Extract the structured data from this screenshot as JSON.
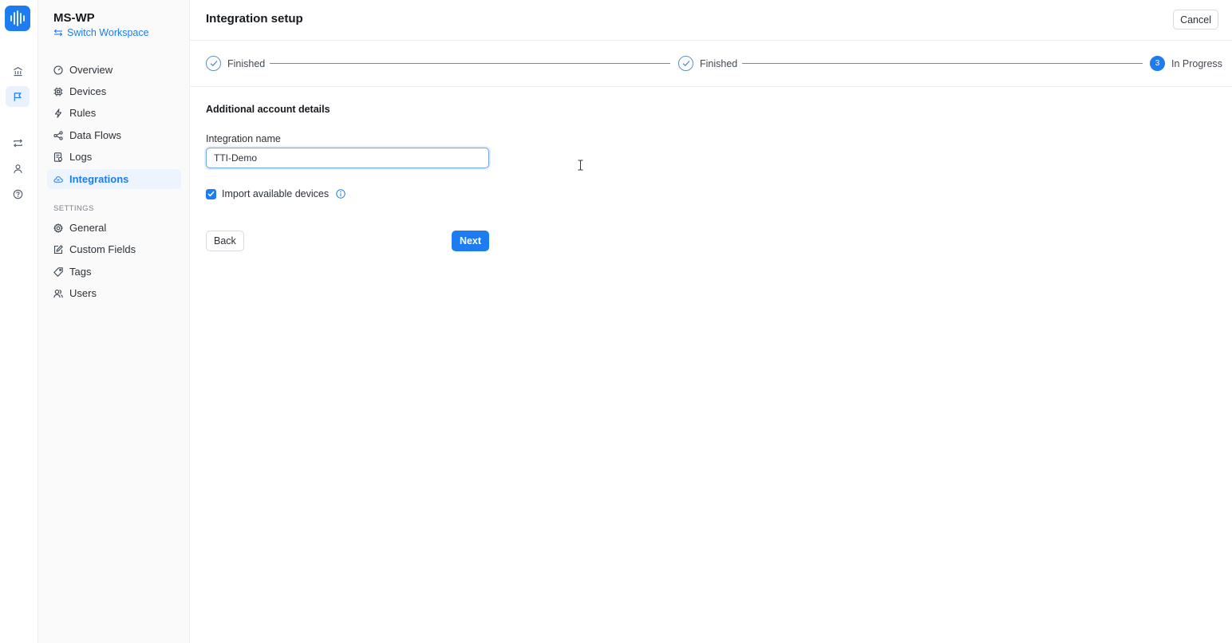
{
  "workspace": {
    "name": "MS-WP",
    "switch_label": "Switch Workspace"
  },
  "rail": {
    "items": [
      "building-icon",
      "flag-icon",
      "transfer-icon",
      "user-icon",
      "help-icon"
    ]
  },
  "sidebar": {
    "items": [
      {
        "label": "Overview",
        "icon": "gauge-icon"
      },
      {
        "label": "Devices",
        "icon": "chip-icon"
      },
      {
        "label": "Rules",
        "icon": "bolt-icon"
      },
      {
        "label": "Data Flows",
        "icon": "share-icon"
      },
      {
        "label": "Logs",
        "icon": "log-icon"
      },
      {
        "label": "Integrations",
        "icon": "cloud-icon",
        "active": true
      }
    ],
    "settings_label": "SETTINGS",
    "settings_items": [
      {
        "label": "General",
        "icon": "gear-icon"
      },
      {
        "label": "Custom Fields",
        "icon": "edit-icon"
      },
      {
        "label": "Tags",
        "icon": "tag-icon"
      },
      {
        "label": "Users",
        "icon": "users-icon"
      }
    ]
  },
  "header": {
    "title": "Integration setup",
    "cancel_label": "Cancel"
  },
  "stepper": {
    "steps": [
      {
        "label": "Finished",
        "state": "finished"
      },
      {
        "label": "Finished",
        "state": "finished"
      },
      {
        "label": "In Progress",
        "state": "current",
        "number": "3"
      }
    ]
  },
  "form": {
    "section_title": "Additional account details",
    "name_label": "Integration name",
    "name_value": "TTI-Demo",
    "import_label": "Import available devices",
    "import_checked": true,
    "back_label": "Back",
    "next_label": "Next"
  },
  "colors": {
    "accent": "#1d7cf2",
    "step_line": "#5a90c8"
  }
}
